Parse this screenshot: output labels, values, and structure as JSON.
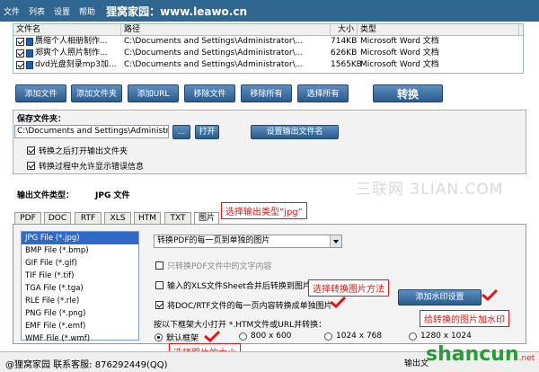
{
  "menu": [
    "文件",
    "列表",
    "设置",
    "帮助"
  ],
  "brand": "狸窝家园：www.leawo.cn",
  "filelist": {
    "headers": [
      "文件名",
      "路径",
      "大小",
      "类型"
    ],
    "rows": [
      {
        "name": "赝缩个人相册制作...",
        "path": "C:\\Documents and Settings\\Administrator\\...",
        "size": "714KB",
        "type": "Microsoft Word 文档"
      },
      {
        "name": "郑爽个人照片制作...",
        "path": "C:\\Documents and Settings\\Administrator\\...",
        "size": "626KB",
        "type": "Microsoft Word 文档"
      },
      {
        "name": "dvd光盘刻录mp3加...",
        "path": "C:\\Documents and Settings\\Administrator\\...",
        "size": "1565KB",
        "type": "Microsoft Word 文档"
      }
    ]
  },
  "buttons": {
    "add_file": "添加文件",
    "add_folder": "添加文件夹",
    "add_url": "添加URL",
    "remove_file": "移除文件",
    "remove_all": "移除所有",
    "select_all": "选择所有",
    "convert": "转换"
  },
  "save": {
    "title": "保存文件夹：",
    "path": "C:\\Documents and Settings\\Administrator\\",
    "browse": "...",
    "open": "打开",
    "set_name": "设置输出文件名",
    "opt1": "转换之后打开输出文件夹",
    "opt2": "转换过程中允许显示错误信息"
  },
  "watermark": "三联网 3LIAN.COM",
  "output_type_label": "输出文件类型：",
  "output_type_value": "JPG 文件",
  "tabs": [
    "PDF",
    "DOC",
    "RTF",
    "XLS",
    "HTM",
    "TXT",
    "图片"
  ],
  "types": [
    "JPG File (*.jpg)",
    "BMP File (*.bmp)",
    "GIF File (*.gif)",
    "TIF File (*.tif)",
    "TGA File (*.tga)",
    "RLE File (*.rle)",
    "PNG File (*.png)",
    "EMF File (*.emf)",
    "WMF File (*.wmf)"
  ],
  "select_value": "转换PDF的每一页到单独的图片",
  "opt_text_only": "只转换PDF文件中的文字内容",
  "opt_xls_merge": "输入的XLS文件Sheet合并后转换到图片",
  "opt_doc_each": "将DOC/RTF文件的每一页内容转换成单独图片",
  "add_watermark_btn": "添加水印设置",
  "frame_label": "按以下框架大小打开 *.HTM文件或URL并转换：",
  "radios": [
    "默认框架",
    "800 x 600",
    "1024 x 768",
    "1280 x 1024"
  ],
  "callouts": {
    "output_type": "选择输出类型”jpg”",
    "convert_method": "选择转换图片方法",
    "watermark": "给转换的图片加水印",
    "size": "选择图片的大小"
  },
  "status": {
    "contact": "@狸窝家园  联系客服: 876292449(QQ)",
    "output": "输出文"
  },
  "logo": {
    "main": "shancun",
    "sub": ".net"
  }
}
